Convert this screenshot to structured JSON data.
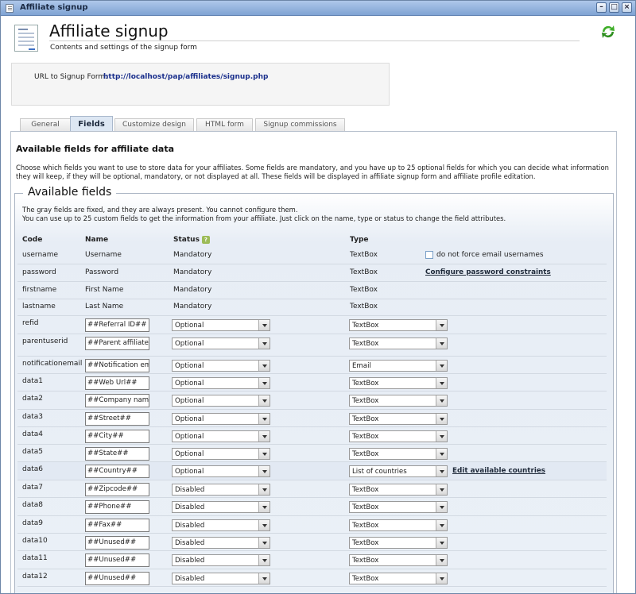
{
  "window": {
    "title": "Affiliate signup"
  },
  "header": {
    "title": "Affiliate signup",
    "subtitle": "Contents and settings of the signup form"
  },
  "url": {
    "label": "URL to Signup Form:",
    "value": "http://localhost/pap/affiliates/signup.php"
  },
  "tabs": [
    "General",
    "Fields",
    "Customize design",
    "HTML form",
    "Signup commissions"
  ],
  "active_tab": "Fields",
  "section": {
    "title": "Available fields for affiliate data",
    "description": "Choose which fields you want to use to store data for your affiliates. Some fields are mandatory, and you have up to 25 optional fields for which you can decide what information they will keep, if they will be optional, mandatory, or not displayed at all. These fields will be displayed in affiliate signup form and affiliate profile editation."
  },
  "fieldset": {
    "legend": "Available fields",
    "info1": "The gray fields are fixed, and they are always present. You cannot configure them.",
    "info2": "You can use up to 25 custom fields to get the information from your affiliate. Just click on the name, type or status to change the field attributes."
  },
  "columns": {
    "code": "Code",
    "name": "Name",
    "status": "Status",
    "type": "Type"
  },
  "fixed_rows": [
    {
      "code": "username",
      "name": "Username",
      "status": "Mandatory",
      "type": "TextBox"
    },
    {
      "code": "password",
      "name": "Password",
      "status": "Mandatory",
      "type": "TextBox"
    },
    {
      "code": "firstname",
      "name": "First Name",
      "status": "Mandatory",
      "type": "TextBox"
    },
    {
      "code": "lastname",
      "name": "Last Name",
      "status": "Mandatory",
      "type": "TextBox"
    }
  ],
  "extras": {
    "email_checkbox_label": "do not force email usernames",
    "password_link": "Configure password constraints",
    "countries_link": "Edit available countries"
  },
  "editable_rows": [
    {
      "code": "refid",
      "name": "##Referral ID##",
      "status": "Optional",
      "type": "TextBox"
    },
    {
      "code": "parentuserid",
      "name": "##Parent affiliate##",
      "status": "Optional",
      "type": "TextBox"
    },
    {
      "code": "notificationemail",
      "name": "##Notification email##",
      "status": "Optional",
      "type": "Email"
    },
    {
      "code": "data1",
      "name": "##Web Url##",
      "status": "Optional",
      "type": "TextBox"
    },
    {
      "code": "data2",
      "name": "##Company name##",
      "status": "Optional",
      "type": "TextBox"
    },
    {
      "code": "data3",
      "name": "##Street##",
      "status": "Optional",
      "type": "TextBox"
    },
    {
      "code": "data4",
      "name": "##City##",
      "status": "Optional",
      "type": "TextBox"
    },
    {
      "code": "data5",
      "name": "##State##",
      "status": "Optional",
      "type": "TextBox"
    },
    {
      "code": "data6",
      "name": "##Country##",
      "status": "Optional",
      "type": "List of countries"
    },
    {
      "code": "data7",
      "name": "##Zipcode##",
      "status": "Disabled",
      "type": "TextBox"
    },
    {
      "code": "data8",
      "name": "##Phone##",
      "status": "Disabled",
      "type": "TextBox"
    },
    {
      "code": "data9",
      "name": "##Fax##",
      "status": "Disabled",
      "type": "TextBox"
    },
    {
      "code": "data10",
      "name": "##Unused##",
      "status": "Disabled",
      "type": "TextBox"
    },
    {
      "code": "data11",
      "name": "##Unused##",
      "status": "Disabled",
      "type": "TextBox"
    },
    {
      "code": "data12",
      "name": "##Unused##",
      "status": "Disabled",
      "type": "TextBox"
    }
  ]
}
